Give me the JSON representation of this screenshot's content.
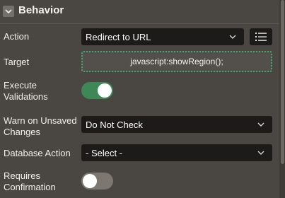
{
  "section": {
    "title": "Behavior",
    "collapse_icon": "chevron-down-icon"
  },
  "fields": {
    "action": {
      "label": "Action",
      "value": "Redirect to URL",
      "list_icon": "list-icon"
    },
    "target": {
      "label": "Target",
      "value": "javascript:showRegion();"
    },
    "execute_validations": {
      "label_line1": "Execute",
      "label_line2": "Validations",
      "state": "on"
    },
    "warn_unsaved": {
      "label_line1": "Warn on Unsaved",
      "label_line2": "Changes",
      "value": "Do Not Check"
    },
    "database_action": {
      "label": "Database Action",
      "value": "- Select -"
    },
    "requires_confirmation": {
      "label_line1": "Requires",
      "label_line2": "Confirmation",
      "state": "off"
    }
  },
  "colors": {
    "background": "#4a4641",
    "field_bg": "#1d1b19",
    "toggle_on": "#3d8856",
    "toggle_off": "#7c7771",
    "focus_border": "#3fa86a"
  }
}
